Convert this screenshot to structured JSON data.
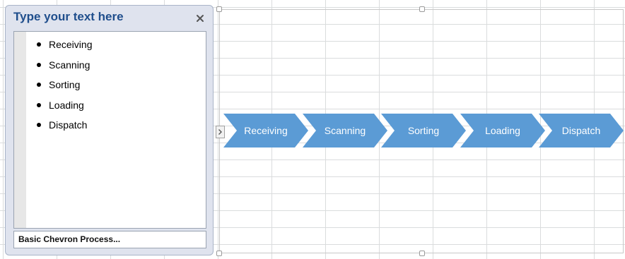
{
  "text_pane": {
    "title": "Type your text here",
    "close_icon": "close-icon",
    "items": [
      "Receiving",
      "Scanning",
      "Sorting",
      "Loading",
      "Dispatch"
    ],
    "layout_name": "Basic Chevron Process..."
  },
  "smartart": {
    "type": "basic-chevron-process",
    "fill_color": "#5b9bd5",
    "text_color": "#ffffff",
    "steps": [
      "Receiving",
      "Scanning",
      "Sorting",
      "Loading",
      "Dispatch"
    ],
    "expander_icon": "chevron-right-icon"
  }
}
